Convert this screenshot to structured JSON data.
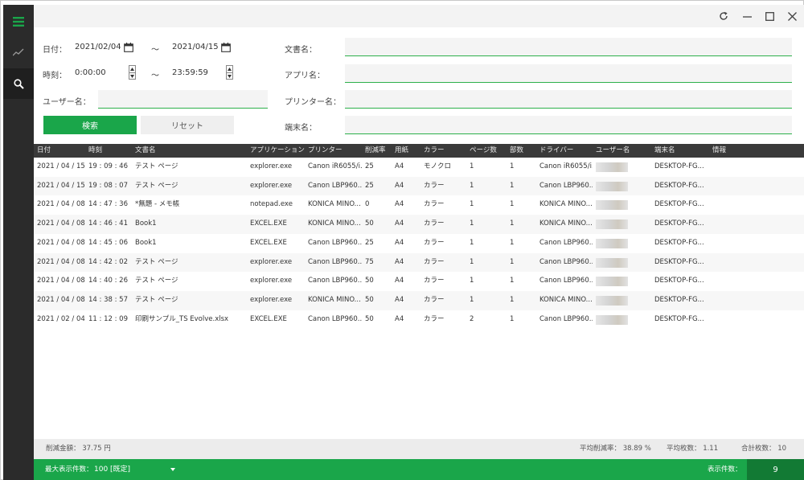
{
  "sidebar": {
    "items": [
      {
        "icon": "menu-icon"
      },
      {
        "icon": "chart-icon"
      },
      {
        "icon": "search-icon"
      }
    ]
  },
  "titlebar": {
    "buttons": [
      "refresh-icon",
      "minimize-icon",
      "maximize-icon",
      "close-icon"
    ]
  },
  "form": {
    "date_label": "日付：",
    "date_from": "2021/02/04",
    "date_to": "2021/04/15",
    "range_sep": "～",
    "time_label": "時刻：",
    "time_from": "0:00:00",
    "time_to": "23:59:59",
    "user_label": "ユーザー名：",
    "user_value": "",
    "doc_label": "文書名：",
    "doc_value": "",
    "app_label": "アプリ名：",
    "app_value": "",
    "printer_label": "プリンター名：",
    "printer_value": "",
    "terminal_label": "端末名：",
    "terminal_value": "",
    "search_button": "検索",
    "reset_button": "リセット"
  },
  "table": {
    "headers": [
      "日付",
      "時刻",
      "文書名",
      "アプリケーション",
      "プリンター",
      "削減率",
      "用紙",
      "カラー",
      "ページ数",
      "部数",
      "ドライバー",
      "ユーザー名",
      "端末名",
      "情報"
    ],
    "rows": [
      [
        "2021 / 04 / 15",
        "19 : 09 : 46",
        "テスト ページ",
        "explorer.exe",
        "Canon iR6055/i...",
        "25",
        "A4",
        "モノクロ",
        "1",
        "1",
        "Canon iR6055/i...",
        "",
        "DESKTOP-FG...",
        ""
      ],
      [
        "2021 / 04 / 15",
        "19 : 08 : 07",
        "テスト ページ",
        "explorer.exe",
        "Canon LBP960...",
        "25",
        "A4",
        "カラー",
        "1",
        "1",
        "Canon LBP960...",
        "",
        "DESKTOP-FG...",
        ""
      ],
      [
        "2021 / 04 / 08",
        "14 : 47 : 36",
        "*無題 - メモ帳",
        "notepad.exe",
        "KONICA MINO...",
        "0",
        "A4",
        "カラー",
        "1",
        "1",
        "KONICA MINO...",
        "",
        "DESKTOP-FG...",
        ""
      ],
      [
        "2021 / 04 / 08",
        "14 : 46 : 41",
        "Book1",
        "EXCEL.EXE",
        "KONICA MINO...",
        "50",
        "A4",
        "カラー",
        "1",
        "1",
        "KONICA MINO...",
        "",
        "DESKTOP-FG...",
        ""
      ],
      [
        "2021 / 04 / 08",
        "14 : 45 : 06",
        "Book1",
        "EXCEL.EXE",
        "Canon LBP960...",
        "25",
        "A4",
        "カラー",
        "1",
        "1",
        "Canon LBP960...",
        "",
        "DESKTOP-FG...",
        ""
      ],
      [
        "2021 / 04 / 08",
        "14 : 42 : 02",
        "テスト ページ",
        "explorer.exe",
        "Canon LBP960...",
        "75",
        "A4",
        "カラー",
        "1",
        "1",
        "Canon LBP960...",
        "",
        "DESKTOP-FG...",
        ""
      ],
      [
        "2021 / 04 / 08",
        "14 : 40 : 26",
        "テスト ページ",
        "explorer.exe",
        "Canon LBP960...",
        "50",
        "A4",
        "カラー",
        "1",
        "1",
        "Canon LBP960...",
        "",
        "DESKTOP-FG...",
        ""
      ],
      [
        "2021 / 04 / 08",
        "14 : 38 : 57",
        "テスト ページ",
        "explorer.exe",
        "KONICA MINO...",
        "50",
        "A4",
        "カラー",
        "1",
        "1",
        "KONICA MINO...",
        "",
        "DESKTOP-FG...",
        ""
      ],
      [
        "2021 / 02 / 04",
        "11 : 12 : 09",
        "印刷サンプル_TS Evolve.xlsx",
        "EXCEL.EXE",
        "Canon LBP960...",
        "50",
        "A4",
        "カラー",
        "2",
        "1",
        "Canon LBP960...",
        "",
        "DESKTOP-FG...",
        ""
      ]
    ]
  },
  "summary": {
    "saved_amount": "削減金額： 37.75 円",
    "avg_reduction": "平均削減率： 38.89 %",
    "avg_sheets": "平均枚数： 1.11",
    "total_sheets": "合計枚数： 10"
  },
  "status": {
    "max_display_label": "最大表示件数：",
    "max_display_value": "100 [既定]",
    "display_count_label": "表示件数：",
    "display_count": "9"
  },
  "colors": {
    "accent": "#1aa64a",
    "accent_dark": "#127a34",
    "sidebar": "#2b2b2b",
    "table_header": "#3a3a3a"
  }
}
